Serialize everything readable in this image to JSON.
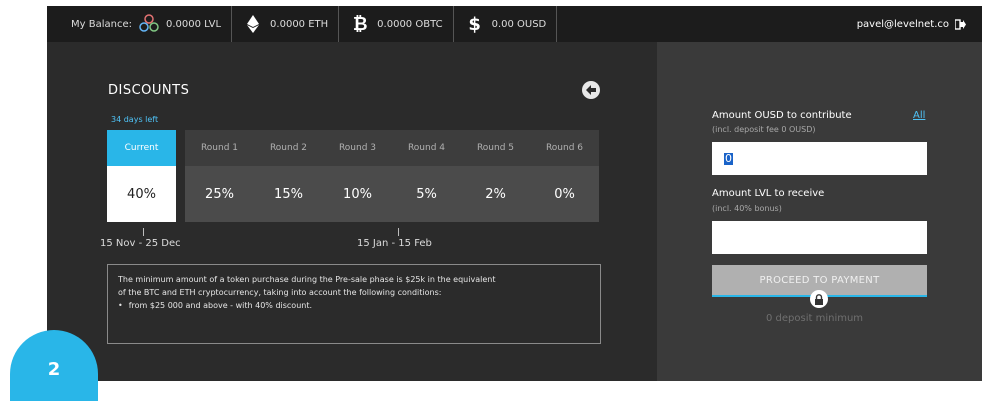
{
  "topbar": {
    "balance_label": "My Balance:",
    "lvl": "0.0000 LVL",
    "eth": "0.0000 ETH",
    "btc": "0.0000 OBTC",
    "usd": "0.00 OUSD",
    "email": "pavel@levelnet.co"
  },
  "discounts": {
    "title": "DISCOUNTS",
    "days_left": "34 days left",
    "current_label": "Current",
    "current_value": "40%",
    "rounds": [
      {
        "label": "Round 1",
        "value": "25%"
      },
      {
        "label": "Round 2",
        "value": "15%"
      },
      {
        "label": "Round 3",
        "value": "10%"
      },
      {
        "label": "Round 4",
        "value": "5%"
      },
      {
        "label": "Round 5",
        "value": "2%"
      },
      {
        "label": "Round 6",
        "value": "0%"
      }
    ],
    "date_start": "15 Nov - 25 Dec",
    "date_mid": "15 Jan - 15 Feb"
  },
  "info": {
    "line1": "The minimum amount of a token purchase during the Pre-sale phase is $25k in the equivalent",
    "line2": "of the BTC and ETH cryptocurrency, taking into account the following conditions:",
    "bullet": "from $25 000 and above - with 40% discount."
  },
  "contribute": {
    "amount_label": "Amount OUSD to contribute",
    "all_link": "All",
    "amount_sub": "(incl. deposit fee 0 OUSD)",
    "amount_value": "0",
    "receive_label": "Amount LVL to receive",
    "receive_sub": "(incl. 40% bonus)",
    "receive_value": "",
    "proceed_label": "PROCEED TO PAYMENT",
    "min_text": "0 deposit minimum"
  },
  "badge": {
    "number": "2"
  },
  "colors": {
    "accent": "#29b6e8",
    "panel": "#2b2b2b",
    "topbar": "#1c1c1c"
  }
}
